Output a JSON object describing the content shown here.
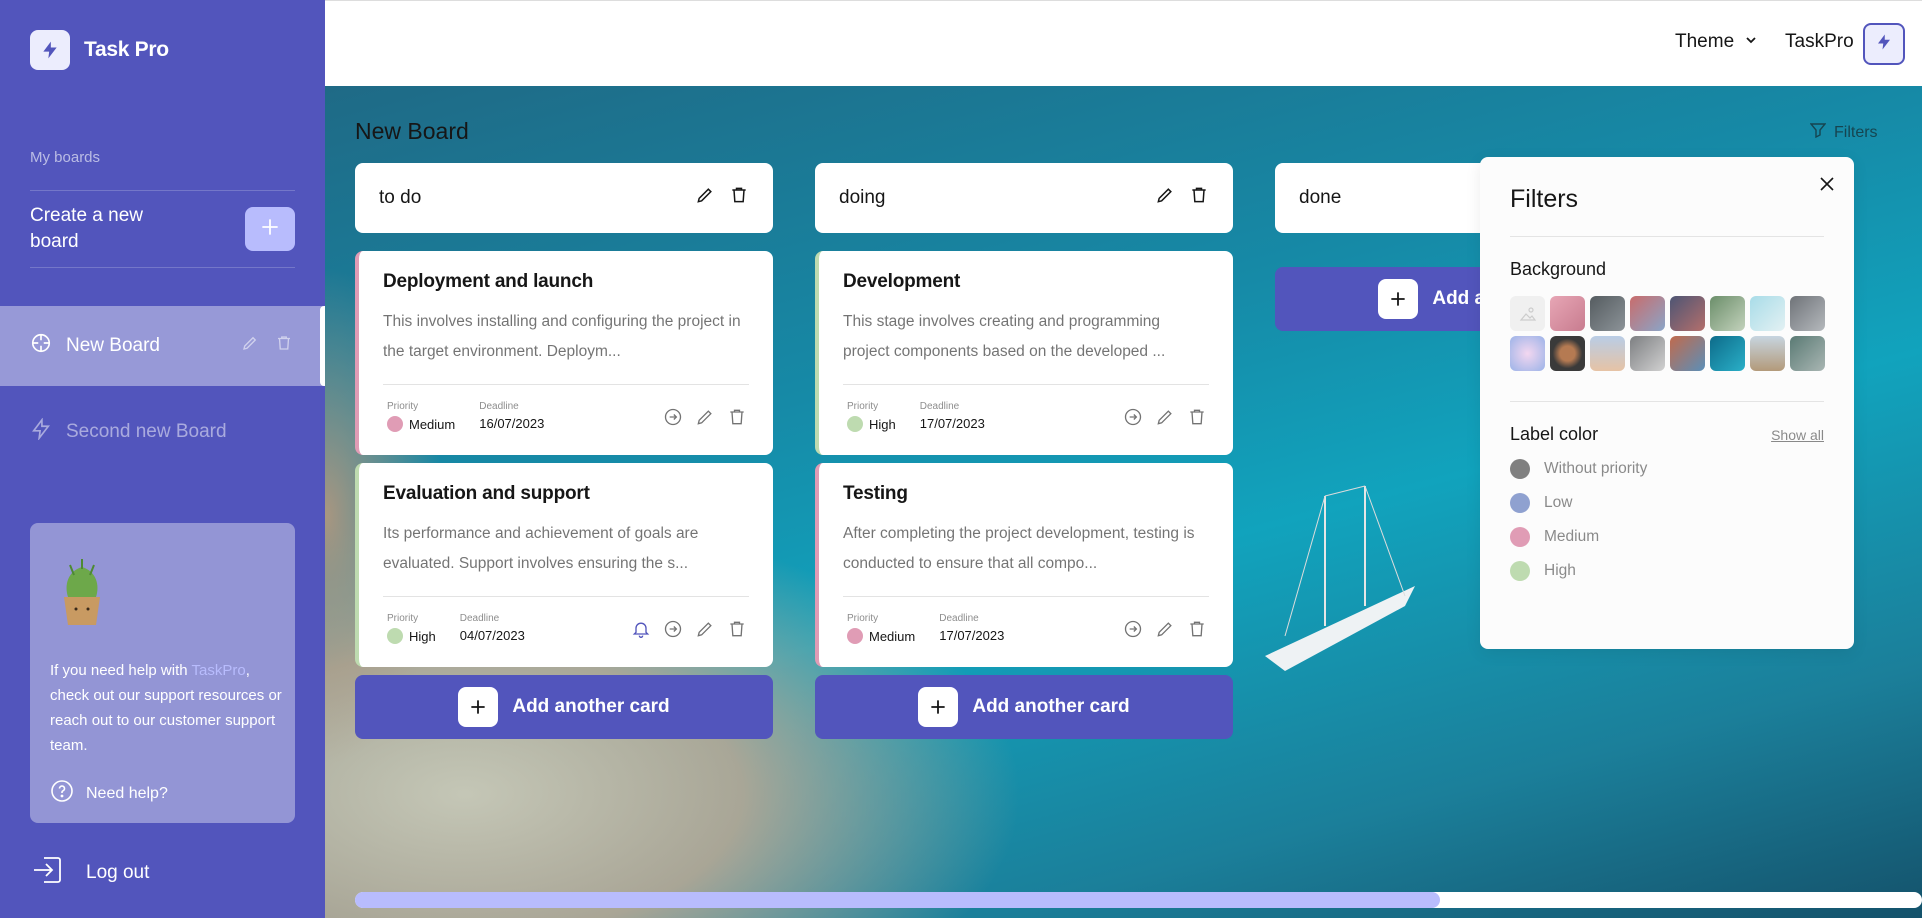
{
  "app": {
    "name": "Task Pro"
  },
  "sidebar": {
    "my_boards_label": "My boards",
    "create_board_label": "Create a new board",
    "boards": [
      {
        "title": "New Board",
        "active": true,
        "icon": "puzzle-icon"
      },
      {
        "title": "Second new Board",
        "active": false,
        "icon": "lightning-icon"
      }
    ],
    "help": {
      "text_before": "If you need help with ",
      "link": "TaskPro",
      "text_after": ", check out our support resources or reach out to our customer support team.",
      "need_help": "Need help?"
    },
    "logout_label": "Log out"
  },
  "header": {
    "theme_label": "Theme",
    "user_name": "TaskPro"
  },
  "board": {
    "title": "New Board",
    "filters_label": "Filters",
    "columns": [
      {
        "title": "to do",
        "cards": [
          {
            "title": "Deployment and launch",
            "description": "This involves installing and configuring the project in the target environment. Deploym...",
            "priority_label": "Priority",
            "priority": "Medium",
            "deadline_label": "Deadline",
            "deadline": "16/07/2023"
          },
          {
            "title": "Evaluation and support",
            "description": "Its performance and achievement of goals are evaluated. Support involves ensuring the s...",
            "priority_label": "Priority",
            "priority": "High",
            "deadline_label": "Deadline",
            "deadline": "04/07/2023"
          }
        ],
        "add_label": "Add another card"
      },
      {
        "title": "doing",
        "cards": [
          {
            "title": "Development",
            "description": "This stage involves creating and programming project components based on the developed ...",
            "priority_label": "Priority",
            "priority": "High",
            "deadline_label": "Deadline",
            "deadline": "17/07/2023"
          },
          {
            "title": "Testing",
            "description": "After completing the project development, testing is conducted to ensure that all compo...",
            "priority_label": "Priority",
            "priority": "Medium",
            "deadline_label": "Deadline",
            "deadline": "17/07/2023"
          }
        ],
        "add_label": "Add another card"
      },
      {
        "title": "done",
        "cards": [],
        "add_label": "Add another card"
      }
    ]
  },
  "filters": {
    "title": "Filters",
    "background_label": "Background",
    "label_color_label": "Label color",
    "show_all": "Show all",
    "options": [
      {
        "label": "Without priority",
        "color": "#808080"
      },
      {
        "label": "Low",
        "color": "#8FA1D0"
      },
      {
        "label": "Medium",
        "color": "#E09CB5"
      },
      {
        "label": "High",
        "color": "#BEDBB0"
      }
    ]
  },
  "colors": {
    "accent": "#5255BC",
    "accent_light": "#B8BCFD",
    "medium": "#E09CB5",
    "high": "#BEDBB0"
  }
}
